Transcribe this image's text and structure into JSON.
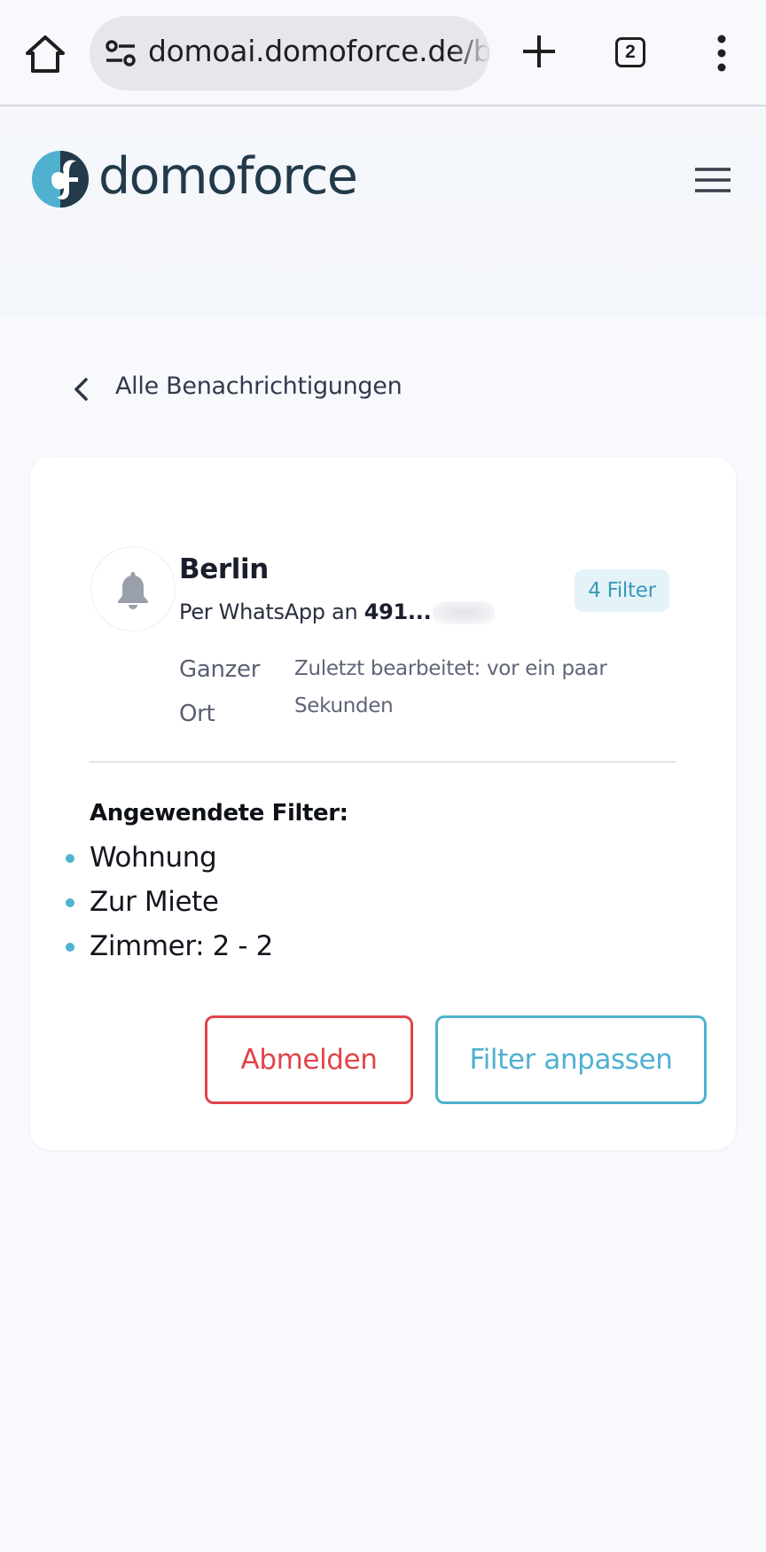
{
  "browser": {
    "url": "domoai.domoforce.de/b",
    "tab_count": "2",
    "icons": [
      "home-icon",
      "site-settings-icon",
      "new-tab-icon",
      "tab-switcher-icon",
      "more-options-icon"
    ]
  },
  "header": {
    "brand_name": "domoforce",
    "menu_icon": "hamburger-menu-icon"
  },
  "nav": {
    "back_label": "Alle Benachrichtigungen"
  },
  "alert": {
    "title": "Berlin",
    "channel_prefix": "Per WhatsApp an",
    "phone_visible": "491...",
    "filter_badge": "4 Filter",
    "scope": "Ganzer Ort",
    "last_edited": "Zuletzt bearbeitet: vor ein paar Sekunden",
    "applied_filters_heading": "Angewendete Filter:",
    "applied_filters": [
      "Wohnung",
      "Zur Miete",
      "Zimmer: 2 - 2"
    ],
    "unsubscribe_label": "Abmelden",
    "edit_filters_label": "Filter anpassen"
  },
  "colors": {
    "accent": "#4fb0cf",
    "danger": "#e0444a",
    "brand_text": "#233a4a",
    "page_bg": "#f8f9fc"
  }
}
